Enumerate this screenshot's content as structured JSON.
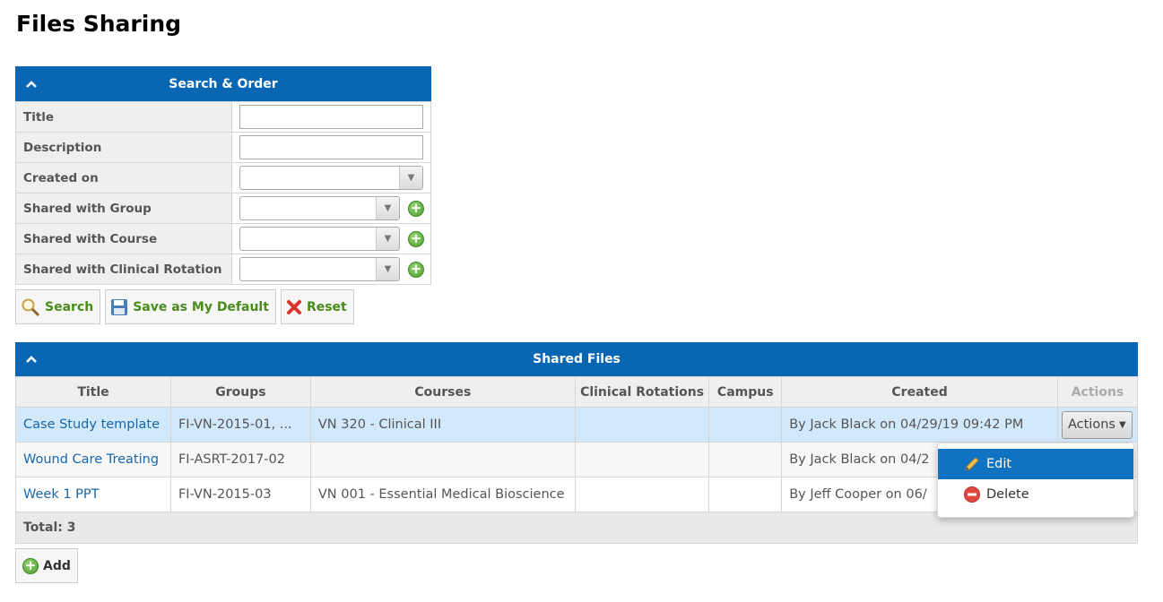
{
  "page": {
    "title": "Files Sharing"
  },
  "search_panel": {
    "title": "Search & Order",
    "fields": [
      {
        "label": "Title",
        "type": "text",
        "value": ""
      },
      {
        "label": "Description",
        "type": "text",
        "value": ""
      },
      {
        "label": "Created on",
        "type": "select",
        "value": ""
      },
      {
        "label": "Shared with Group",
        "type": "select",
        "value": ""
      },
      {
        "label": "Shared with Course",
        "type": "select",
        "value": ""
      },
      {
        "label": "Shared with Clinical Rotation",
        "type": "select",
        "value": ""
      }
    ],
    "buttons": {
      "search": "Search",
      "save_default": "Save as My Default",
      "reset": "Reset"
    }
  },
  "files_panel": {
    "title": "Shared Files",
    "columns": [
      "Title",
      "Groups",
      "Courses",
      "Clinical Rotations",
      "Campus",
      "Created",
      "Actions"
    ],
    "rows": [
      {
        "title": "Case Study template",
        "groups": "FI-VN-2015-01, ...",
        "courses": "VN 320 - Clinical III",
        "rotations": "",
        "campus": "",
        "created": "By Jack Black on 04/29/19 09:42 PM",
        "actions": "Actions"
      },
      {
        "title": "Wound Care Treating",
        "groups": "FI-ASRT-2017-02",
        "courses": "",
        "rotations": "",
        "campus": "",
        "created": "By Jack Black on 04/2",
        "actions": ""
      },
      {
        "title": "Week 1 PPT",
        "groups": "FI-VN-2015-03",
        "courses": "VN 001 - Essential Medical Bioscience",
        "rotations": "",
        "campus": "",
        "created": "By Jeff Cooper on 06/",
        "actions": ""
      }
    ],
    "total_label": "Total: 3"
  },
  "dropdown": {
    "items": [
      {
        "label": "Edit",
        "icon": "pencil-icon"
      },
      {
        "label": "Delete",
        "icon": "delete-icon"
      }
    ]
  },
  "add_button": {
    "label": "Add"
  },
  "colors": {
    "header_blue": "#0866b3",
    "selected_row": "#d2e9fb",
    "link": "#1a67a8",
    "button_text_green": "#4a8c1c",
    "dropdown_active": "#0f73c2"
  }
}
